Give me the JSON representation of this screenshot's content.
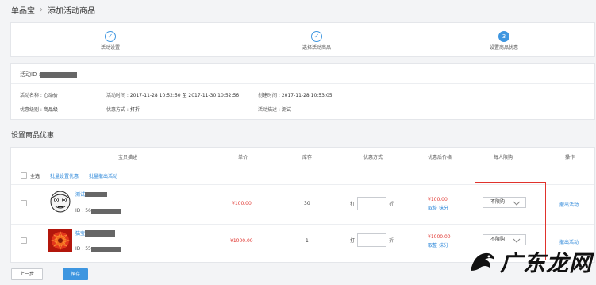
{
  "breadcrumb": {
    "root": "单品宝",
    "separator": "›",
    "current": "添加活动商品"
  },
  "steps": [
    {
      "label": "活动设置",
      "marker": "✓"
    },
    {
      "label": "选择活动商品",
      "marker": "✓"
    },
    {
      "label": "设置商品优惠",
      "marker": "3"
    }
  ],
  "activity": {
    "id_label": "活动ID :",
    "name_label": "活动名称 :",
    "name_value": "心动价",
    "time_label": "活动时间 :",
    "time_value": "2017-11-28 10:52:50 至 2017-11-30 10:52:56",
    "created_label": "创建时间 :",
    "created_value": "2017-11-28 10:53:05",
    "level_label": "优惠级别 :",
    "level_value": "商品级",
    "method_label": "优惠方式 :",
    "method_value": "打折",
    "desc_label": "活动描述 :",
    "desc_value": "测试"
  },
  "section_title": "设置商品优惠",
  "table": {
    "headers": [
      "宝贝描述",
      "单价",
      "库存",
      "优惠方式",
      "优惠后价格",
      "每人限购",
      "操作"
    ],
    "select_all": "全选",
    "bulk_set": "批量设置优惠",
    "bulk_remove": "批量撤出活动",
    "rows": [
      {
        "title": "测试",
        "id_prefix": "ID : 56",
        "price": "¥100.00",
        "stock": "30",
        "discount_prefix": "打",
        "discount_suffix": "折",
        "after_price": "¥100.00",
        "round": "取整",
        "erase": "抹分",
        "limit": "不限购",
        "action": "撤出活动"
      },
      {
        "title": "猫宝",
        "id_prefix": "ID : 55",
        "price": "¥1000.00",
        "stock": "1",
        "discount_prefix": "打",
        "discount_suffix": "折",
        "after_price": "¥1000.00",
        "round": "取整",
        "erase": "抹分",
        "limit": "不限购",
        "action": "撤出活动"
      }
    ]
  },
  "buttons": {
    "prev": "上一步",
    "save": "保存"
  },
  "watermark": "广东龙网",
  "colors": {
    "accent": "#3e96e0",
    "price": "#e0322c",
    "link": "#2a86d9",
    "highlight_border": "#e0322c"
  },
  "icons": {
    "check": "check-icon",
    "dropdown": "chevron-down-icon",
    "avatar1": "cartoon-face-avatar",
    "avatar2": "red-flower-thumbnail",
    "watermark_logo": "dragon-logo-icon"
  }
}
